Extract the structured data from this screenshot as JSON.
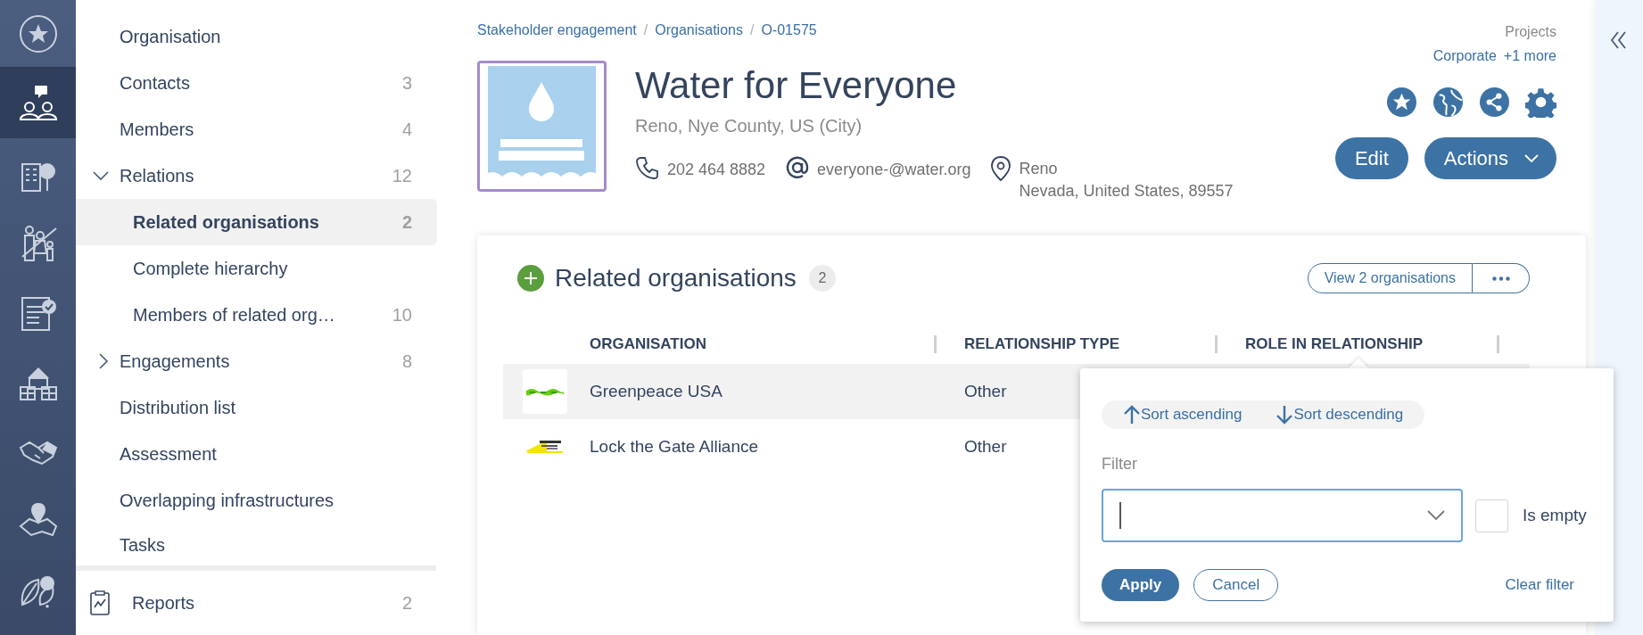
{
  "rail": {
    "items": [
      {
        "kind": "favorites",
        "selected": false
      },
      {
        "kind": "stakeholders",
        "selected": true
      },
      {
        "kind": "organisations",
        "selected": false
      },
      {
        "kind": "people",
        "selected": false
      },
      {
        "kind": "tasks",
        "selected": false
      },
      {
        "kind": "properties",
        "selected": false
      },
      {
        "kind": "agreements",
        "selected": false
      },
      {
        "kind": "locations",
        "selected": false
      },
      {
        "kind": "environment",
        "selected": false
      }
    ]
  },
  "sidebar": {
    "items": [
      {
        "label": "Organisation",
        "selected": false
      },
      {
        "label": "Contacts",
        "count": "3",
        "selected": false
      },
      {
        "label": "Members",
        "count": "4",
        "selected": false
      },
      {
        "label": "Relations",
        "count": "12",
        "selected": false,
        "expanded": true,
        "children": [
          {
            "label": "Related organisations",
            "count": "2",
            "selected": true
          },
          {
            "label": "Complete hierarchy",
            "selected": false
          },
          {
            "label": "Members of related org…",
            "count": "10",
            "selected": false
          }
        ]
      },
      {
        "label": "Engagements",
        "count": "8",
        "selected": false,
        "expanded": false
      },
      {
        "label": "Distribution list",
        "selected": false
      },
      {
        "label": "Assessment",
        "selected": false
      },
      {
        "label": "Overlapping infrastructures",
        "selected": false
      },
      {
        "label": "Tasks",
        "selected": false
      }
    ],
    "reports": {
      "label": "Reports",
      "count": "2"
    }
  },
  "breadcrumb": {
    "separator": "/",
    "items": [
      "Stakeholder engagement",
      "Organisations",
      "O-01575"
    ]
  },
  "organisation": {
    "name": "Water for Everyone",
    "location": "Reno, Nye County, US (City)",
    "phone": "202 464 8882",
    "email": "everyone-@water.org",
    "address": [
      "Reno",
      "Nevada, United States, 89557"
    ]
  },
  "projects": {
    "label": "Projects",
    "items": [
      "Corporate"
    ],
    "more": "+1 more"
  },
  "buttons": {
    "edit": "Edit",
    "actions": "Actions"
  },
  "related": {
    "title": "Related organisations",
    "count": "2",
    "view_button": "View 2 organisations",
    "columns": [
      "ORGANISATION",
      "RELATIONSHIP TYPE",
      "ROLE IN RELATIONSHIP"
    ],
    "rows": [
      {
        "organisation": "Greenpeace USA",
        "relationship_type": "Other",
        "highlighted": true
      },
      {
        "organisation": "Lock the Gate Alliance",
        "relationship_type": "Other",
        "highlighted": false
      }
    ]
  },
  "column_menu": {
    "sort_ascending": "Sort ascending",
    "sort_descending": "Sort descending",
    "filter_label": "Filter",
    "is_empty": {
      "label": "Is empty",
      "checked": false
    },
    "apply": "Apply",
    "cancel": "Cancel",
    "clear": "Clear filter"
  }
}
